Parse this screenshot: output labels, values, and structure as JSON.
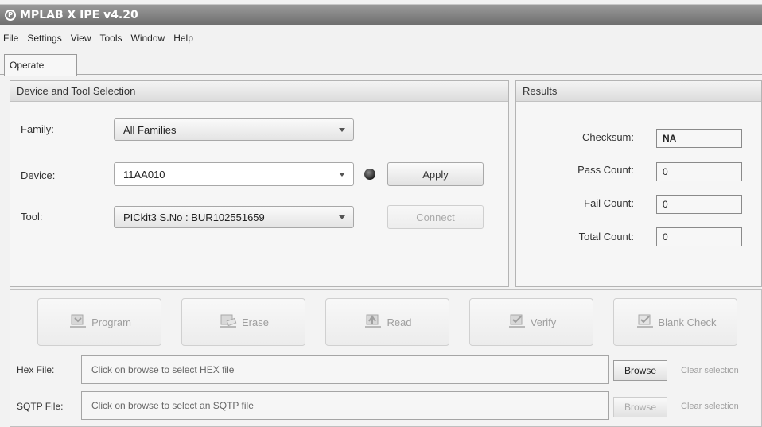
{
  "window": {
    "title": "MPLAB X IPE v4.20"
  },
  "menu": [
    "File",
    "Settings",
    "View",
    "Tools",
    "Window",
    "Help"
  ],
  "tabs": [
    {
      "label": "Operate",
      "active": true
    }
  ],
  "device_panel": {
    "header": "Device and Tool Selection",
    "family_label": "Family:",
    "family_value": "All Families",
    "device_label": "Device:",
    "device_value": "11AA010",
    "apply_label": "Apply",
    "tool_label": "Tool:",
    "tool_value": "PICkit3 S.No : BUR102551659",
    "connect_label": "Connect"
  },
  "results_panel": {
    "header": "Results",
    "checksum_label": "Checksum:",
    "checksum_value": "NA",
    "pass_label": "Pass Count:",
    "pass_value": "0",
    "fail_label": "Fail Count:",
    "fail_value": "0",
    "total_label": "Total Count:",
    "total_value": "0"
  },
  "actions": {
    "program": "Program",
    "erase": "Erase",
    "read": "Read",
    "verify": "Verify",
    "blank_check": "Blank Check"
  },
  "hex_file": {
    "label": "Hex File:",
    "placeholder": "Click on browse to select HEX file",
    "browse": "Browse",
    "clear": "Clear selection"
  },
  "sqtp_file": {
    "label": "SQTP File:",
    "placeholder": "Click on browse to select an SQTP file",
    "browse": "Browse",
    "clear": "Clear selection"
  },
  "icons": {
    "app": "mplab-logo-icon",
    "dropdown": "chevron-down-icon",
    "status": "status-led-icon",
    "program": "chip-program-icon",
    "erase": "chip-erase-icon",
    "read": "chip-read-icon",
    "verify": "chip-verify-icon",
    "blank_check": "chip-blank-check-icon"
  },
  "colors": {
    "titlebar": "#7d7d7d",
    "disabled_text": "#aaaaaa"
  }
}
